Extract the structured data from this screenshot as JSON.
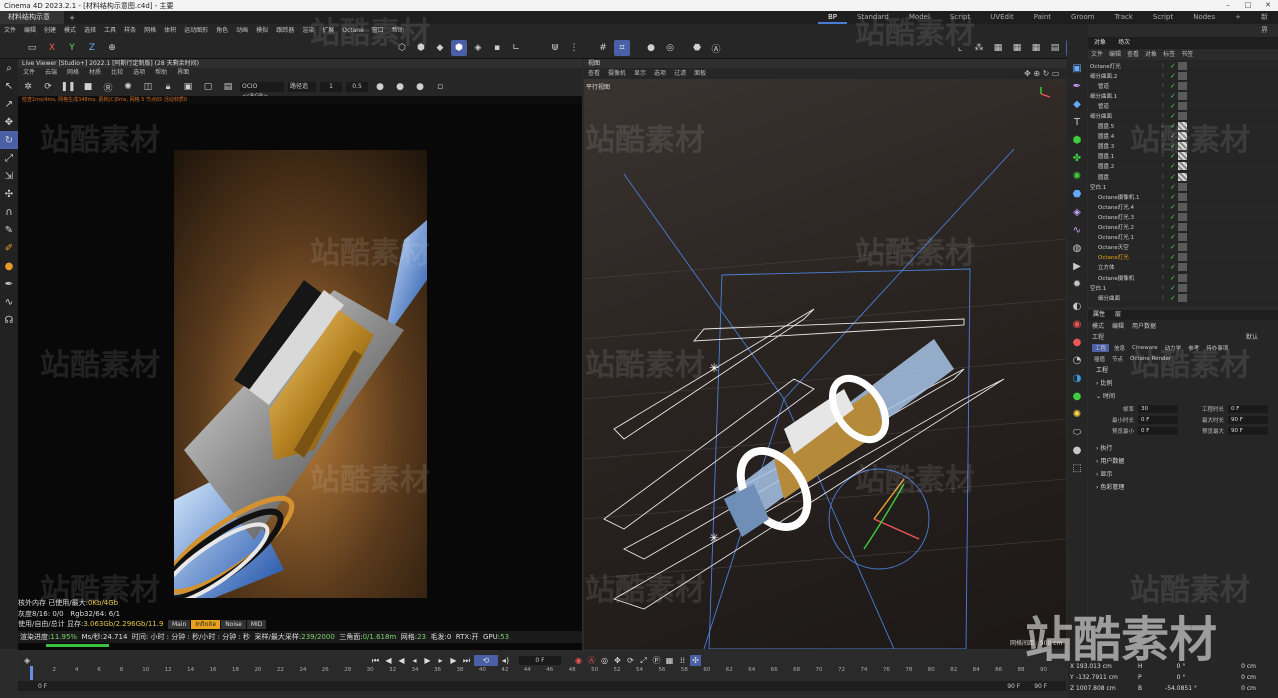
{
  "window": {
    "app_title": "Cinema 4D 2023.2.1 - [材料结构示意图.c4d] - 主要"
  },
  "doc_tab": {
    "name": "材料结构示意图.c4d",
    "add": "+"
  },
  "layouts": [
    {
      "label": "BP"
    },
    {
      "label": "Standard"
    },
    {
      "label": "Model"
    },
    {
      "label": "Script"
    },
    {
      "label": "UVEdit"
    },
    {
      "label": "Paint"
    },
    {
      "label": "Groom"
    },
    {
      "label": "Track"
    },
    {
      "label": "Script"
    },
    {
      "label": "Nodes"
    }
  ],
  "layout_extra": {
    "add": "+",
    "new_layout": "新界面"
  },
  "menu": [
    "文件",
    "编辑",
    "创建",
    "模式",
    "选择",
    "工具",
    "样条",
    "网格",
    "体积",
    "运动图形",
    "角色",
    "动画",
    "模拟",
    "跟踪器",
    "渲染",
    "扩展",
    "Octane",
    "窗口",
    "帮助"
  ],
  "toolbar": {
    "x": "X",
    "y": "Y",
    "z": "Z"
  },
  "live_viewer": {
    "title": "Live Viewer [Studio+] 2022.1 [阿斯行定制版] (28 天剩余时间)",
    "menu": [
      "文件",
      "云端",
      "网格",
      "材质",
      "比较",
      "选项",
      "帮助",
      "界面"
    ],
    "color_space": "OCIO <sRGB>",
    "mode": "路径追",
    "value1": "1",
    "value2": "0.5",
    "status_line": "检查1ms/4ms, 网格生成348ms, 更新[C]0ms, 网格 5 节点65 活动材质0",
    "stats": [
      {
        "label": "核外内存 已使用/最大:",
        "value": "0Kb/4Gb"
      },
      {
        "label": "灰度8/16:",
        "value": "0/0",
        "extra": "Rgb32/64: 6/1"
      },
      {
        "label": "使用/自由/总计 显存:",
        "value": "3.063Gb/2.296Gb/11.9"
      }
    ],
    "passes": [
      "Main",
      "Infinite",
      "Noise",
      "MID"
    ],
    "bottom": {
      "progress_label": "渲染进度:",
      "progress": "11.95%",
      "ms_label": "Ms/秒:",
      "ms": "24.714",
      "time": "时间: 小时 : 分钟 : 秒/小时 : 分钟 : 秒",
      "samples_label": "采样/最大采样:",
      "samples": "239/2000",
      "tri_label": "三角面:",
      "tri": "0/1.618m",
      "mesh_label": "网格:",
      "mesh": "23",
      "hair_label": "毛发:",
      "hair": "0",
      "rtx_label": "RTX:",
      "rtx": "开",
      "gpu_label": "GPU:",
      "gpu": "53"
    },
    "progress_fraction": 0.1195
  },
  "viewport": {
    "header": "视图",
    "menu": [
      "查看",
      "摄像机",
      "显示",
      "选项",
      "过滤",
      "面板"
    ],
    "label": "平行视图",
    "grid": "网格间距 : 500 cm"
  },
  "object_manager": {
    "tabs": [
      "对象",
      "场次"
    ],
    "menu": [
      "文件",
      "编辑",
      "查看",
      "对象",
      "标签",
      "书签"
    ],
    "rows": [
      {
        "name": "Octane灯光"
      },
      {
        "name": "细分曲面.2"
      },
      {
        "name": "管道"
      },
      {
        "name": "细分曲面.1"
      },
      {
        "name": "管道"
      },
      {
        "name": "细分曲面"
      },
      {
        "name": "圆盘.5"
      },
      {
        "name": "圆盘.4"
      },
      {
        "name": "圆盘.3"
      },
      {
        "name": "圆盘.1"
      },
      {
        "name": "圆盘.2"
      },
      {
        "name": "圆盘"
      },
      {
        "name": "空白.1"
      },
      {
        "name": "Octane摄像机.1"
      },
      {
        "name": "Octane灯光.4"
      },
      {
        "name": "Octane灯光.3"
      },
      {
        "name": "Octane灯光.2"
      },
      {
        "name": "Octane灯光.1"
      },
      {
        "name": "Octane天空"
      },
      {
        "name": "Octane灯光"
      },
      {
        "name": "立方体"
      },
      {
        "name": "Octane摄像机"
      },
      {
        "name": "空白.1"
      },
      {
        "name": "细分曲面"
      }
    ]
  },
  "attributes": {
    "tabs": [
      "属性",
      "层"
    ],
    "menu": [
      "模式",
      "编辑",
      "用户数据"
    ],
    "title": "工程",
    "preset": "默认",
    "sub_tabs": [
      "工程",
      "信息",
      "Cineware",
      "动力学",
      "参考",
      "待办事项"
    ],
    "sub_tabs2": [
      "插值",
      "节点",
      "Octane Render"
    ],
    "section": "工程",
    "sections": [
      "比例",
      "时间",
      "执行",
      "用户数据",
      "显示",
      "色彩管理"
    ],
    "fields": [
      {
        "label": "帧率",
        "value": "30",
        "label2": "工程时长",
        "value2": "0 F"
      },
      {
        "label": "最小时长",
        "value": "0 F",
        "label2": "最大时长",
        "value2": "90 F"
      },
      {
        "label": "预览最小",
        "value": "0 F",
        "label2": "预览最大",
        "value2": "90 F"
      }
    ]
  },
  "timeline": {
    "current_frame": "0 F",
    "ticks": [
      "0",
      "2",
      "4",
      "6",
      "8",
      "10",
      "12",
      "14",
      "16",
      "18",
      "20",
      "22",
      "24",
      "26",
      "28",
      "30",
      "32",
      "34",
      "36",
      "38",
      "40",
      "42",
      "44",
      "46",
      "48",
      "50",
      "52",
      "54",
      "56",
      "58",
      "60",
      "62",
      "64",
      "66",
      "68",
      "70",
      "72",
      "74",
      "76",
      "78",
      "80",
      "82",
      "84",
      "86",
      "88",
      "90"
    ],
    "start": "0 F",
    "end1": "90 F",
    "end2": "90 F"
  },
  "coordinates": {
    "rows": [
      {
        "axis": "X",
        "pos": "193.013 cm",
        "rot_axis": "H",
        "rot": "0 °",
        "size": "0 cm"
      },
      {
        "axis": "Y",
        "pos": "-132.7911 cm",
        "rot_axis": "P",
        "rot": "0 °",
        "size": "0 cm"
      },
      {
        "axis": "Z",
        "pos": "1007.808 cm",
        "rot_axis": "B",
        "rot": "-54.0851 °",
        "size": "0 cm"
      }
    ]
  },
  "watermark_text": "站酷素材",
  "colors": {
    "accent": "#4b5fa6",
    "progress": "#3ec13e",
    "pass_active": "#e6a21e",
    "status": "#d06a20"
  }
}
